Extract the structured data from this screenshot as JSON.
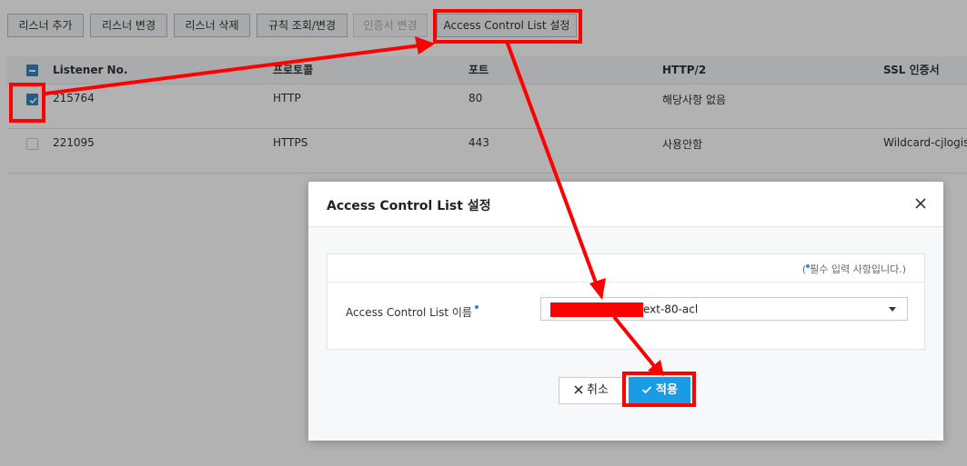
{
  "toolbar": {
    "buttons": [
      {
        "label": "리스너 추가"
      },
      {
        "label": "리스너 변경"
      },
      {
        "label": "리스너 삭제"
      },
      {
        "label": "규칙 조회/변경"
      },
      {
        "label": "인증서 변경"
      },
      {
        "label": "Access Control List 설정"
      }
    ]
  },
  "table": {
    "headers": [
      "Listener No.",
      "프로토콜",
      "포트",
      "HTTP/2",
      "SSL 인증서"
    ],
    "rows": [
      {
        "listener_no": "215764",
        "protocol": "HTTP",
        "port": "80",
        "http2": "해당사항 없음",
        "ssl": "",
        "checked": true
      },
      {
        "listener_no": "221095",
        "protocol": "HTTPS",
        "port": "443",
        "http2": "사용안함",
        "ssl": "Wildcard-cjlogisti",
        "checked": false
      }
    ]
  },
  "modal": {
    "title": "Access Control List 설정",
    "required_note_prefix": "(",
    "required_note_text": "필수 입력 사항입니다.)",
    "field_label": "Access Control List 이름",
    "select_value_suffix": "ext-80-acl",
    "cancel_label": "취소",
    "apply_label": "적용"
  },
  "colors": {
    "accent": "#1a9be6",
    "checkbox": "#2f87c6",
    "annotation": "#ff0000"
  }
}
